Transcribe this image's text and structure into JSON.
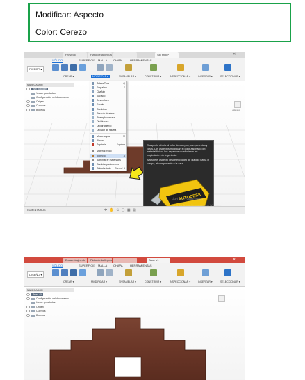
{
  "note": {
    "line1": "Modificar: Aspecto",
    "line2": "Color: Cerezo"
  },
  "screenshot1": {
    "tabs": [
      "Proyecto",
      "Plato de la lleguada",
      "",
      "Sin título*"
    ],
    "ribbon_tabs": [
      "SÓLIDO",
      "SUPERFICIE",
      "MALLA",
      "CHAPA",
      "HERRAMIENTAS"
    ],
    "workspace": "DISEÑO ▾",
    "groups": [
      "CREAR ▾",
      "MODIFICAR ▾",
      "ENSAMBLAR ▾",
      "CONSTRUIR ▾",
      "INSPECCIONAR ▾",
      "INSERTAR ▾",
      "SELECCIONAR ▾"
    ],
    "browser": {
      "header": "NAVEGADOR",
      "items": [
        "(sin guardar)",
        "Vistas guardadas",
        "Configuración del documento",
        "Origen",
        "Cuerpos",
        "Bocetos"
      ]
    },
    "menu": {
      "items": [
        {
          "label": "Pulsar/Tirar",
          "shortcut": "Q"
        },
        {
          "label": "Empalme",
          "shortcut": "F"
        },
        {
          "label": "Chaflán",
          "shortcut": ""
        },
        {
          "label": "Vaciado",
          "shortcut": ""
        },
        {
          "label": "Desmoldeo",
          "shortcut": ""
        },
        {
          "label": "Escala",
          "shortcut": ""
        },
        {
          "label": "Combinar",
          "shortcut": ""
        },
        {
          "label": "Cara de desfase",
          "shortcut": ""
        },
        {
          "label": "Reemplazar cara",
          "shortcut": ""
        },
        {
          "label": "Dividir cara",
          "shortcut": ""
        },
        {
          "label": "Dividir cuerpo",
          "shortcut": ""
        },
        {
          "label": "División de silueta",
          "shortcut": ""
        },
        {
          "label": "Mover/copiar",
          "shortcut": "M"
        },
        {
          "label": "Alinear",
          "shortcut": ""
        },
        {
          "label": "Suprimir",
          "shortcut": "Suprimir"
        },
        {
          "label": "Material físico",
          "shortcut": ""
        },
        {
          "label": "Aspecto",
          "shortcut": "A"
        },
        {
          "label": "Administrar materiales",
          "shortcut": ""
        },
        {
          "label": "Cambiar parámetros",
          "shortcut": ""
        },
        {
          "label": "Calcular todo",
          "shortcut": "Control+B"
        }
      ]
    },
    "tooltip": {
      "text1": "El aspecto afecta al color de cuerpos, componentes y caras. Los aspectos modifican el color asignado del material físico. Los aspectos no afectan a las propiedades de ingeniería.",
      "text2": "Arrastre el aspecto desde el cuadro de diálogo hasta el cuerpo, el componente o la cara.",
      "brand": "AUTODESK"
    },
    "watermark": "Activar Windows",
    "watermark_sub": "Ve a Configuración para activar Windows.",
    "bottom_label": "COMENTARIOS",
    "view_label": "ARRIBA"
  },
  "screenshot2": {
    "tabs": [
      "Ensamblajes.sk",
      "Plato de la lleguada",
      "",
      "Base v1"
    ],
    "ribbon_tabs": [
      "SÓLIDO",
      "SUPERFICIE",
      "MALLA",
      "CHAPA",
      "HERRAMIENTAS"
    ],
    "workspace": "DISEÑO ▾",
    "groups": [
      "CREAR ▾",
      "MODIFICAR ▾",
      "ENSAMBLAR ▾",
      "CONSTRUIR ▾",
      "INSPECCIONAR ▾",
      "INSERTAR ▾",
      "SELECCIONAR ▾"
    ],
    "browser": {
      "header": "NAVEGADOR",
      "items": [
        "Base v1",
        "Configuración del documento",
        "Vistas guardadas",
        "Origen",
        "Cuerpos",
        "Bocetos"
      ]
    }
  },
  "colors": {
    "note_border": "#1aa24a",
    "cherry_wood": "#6e3b2a",
    "highlight_blue": "#1b6fd6",
    "tooltip_bg": "#2b2b2b",
    "cutter_yellow": "#f1c40f"
  }
}
